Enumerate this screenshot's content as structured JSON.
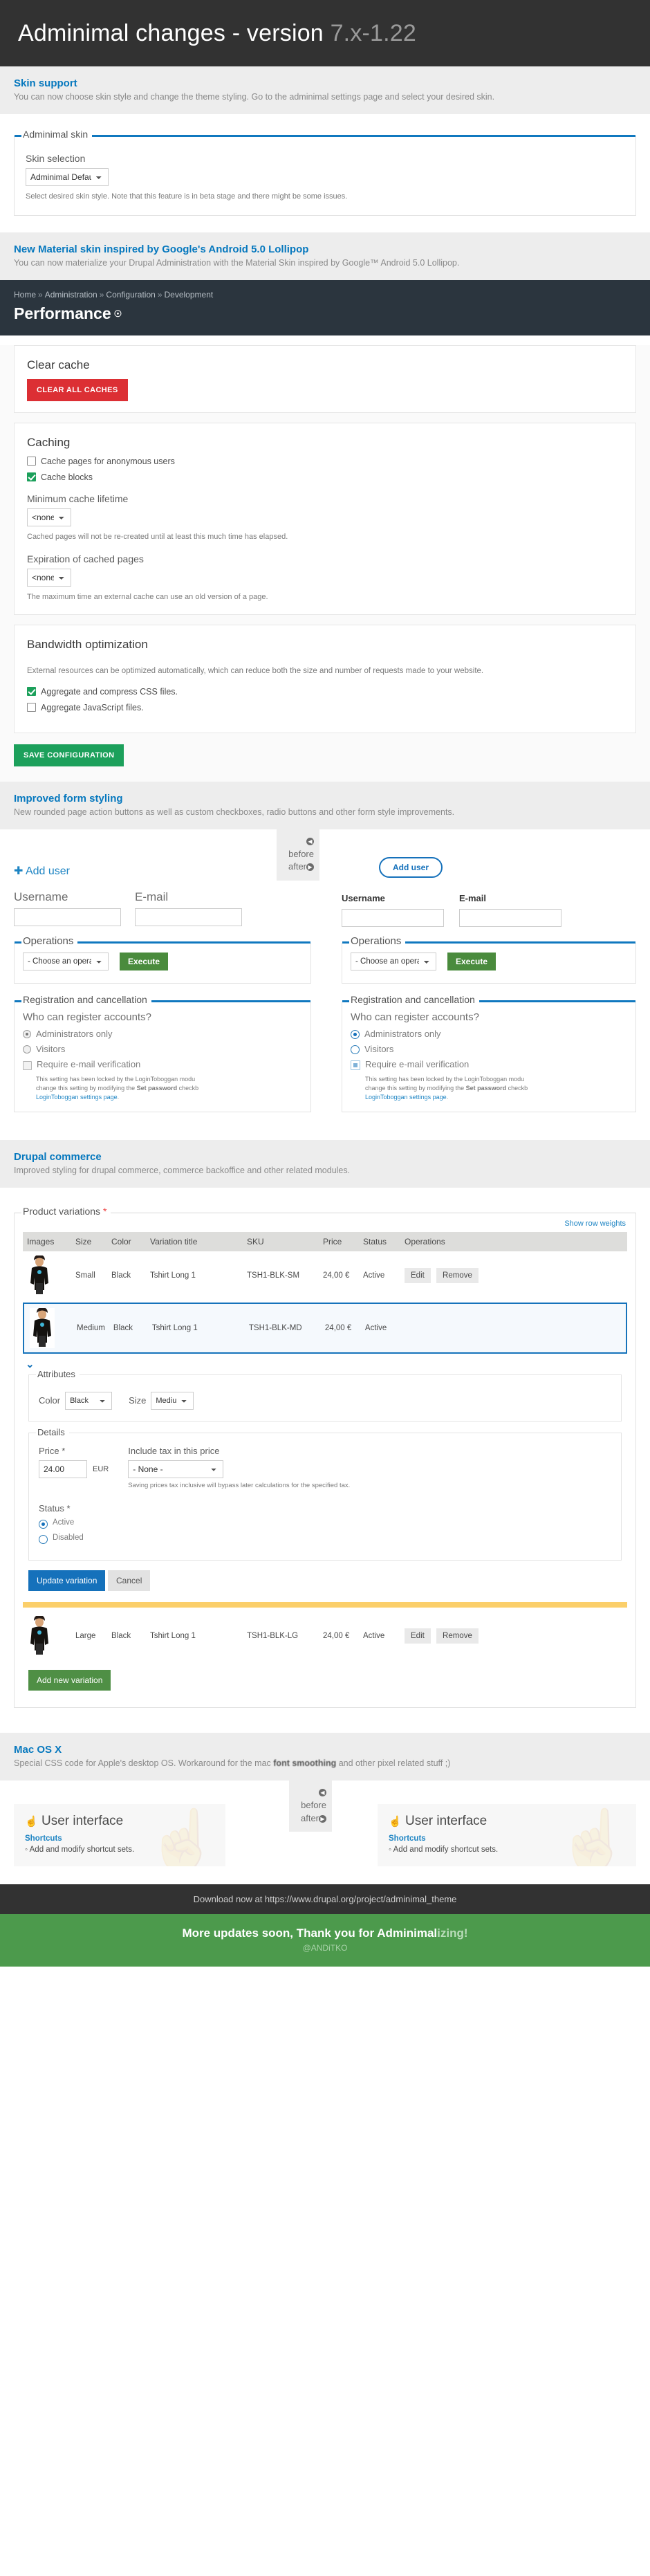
{
  "hero": {
    "title": "Adminimal changes - version ",
    "version": "7.x-1.22"
  },
  "promos": {
    "skin": {
      "heading": "Skin support",
      "text": "You can now choose skin style and change the theme styling. Go to the adminimal settings page and select your desired skin."
    },
    "material": {
      "heading": "New Material skin inspired by Google's Android 5.0 Lollipop",
      "text": "You can now materialize your Drupal Administration with the Material Skin inspired by Google™ Android 5.0 Lollipop."
    },
    "forms": {
      "heading": "Improved form styling",
      "text": "New rounded page action buttons as well as custom checkboxes, radio buttons and other form style improvements."
    },
    "commerce": {
      "heading": "Drupal commerce",
      "text": "Improved styling for drupal commerce, commerce backoffice and other related modules."
    },
    "macos": {
      "heading": "Mac OS X",
      "text_before": "Special CSS code for Apple's desktop OS. Workaround for the mac ",
      "text_highlight": "font smoothing",
      "text_after": " and other pixel related stuff ;)"
    }
  },
  "skin_fieldset": {
    "legend": "Adminimal skin",
    "field_label": "Skin selection",
    "selected": "Adminimal Default",
    "description": "Select desired skin style. Note that this feature is in beta stage and there might be some issues."
  },
  "admin_header": {
    "breadcrumb": [
      "Home",
      "Administration",
      "Configuration",
      "Development"
    ],
    "title": "Performance",
    "title_icon": "settings-icon"
  },
  "performance": {
    "clear_cache": {
      "heading": "Clear cache",
      "button": "CLEAR ALL CACHES"
    },
    "caching": {
      "heading": "Caching",
      "checkbox_anonymous": {
        "label": "Cache pages for anonymous users",
        "checked": false
      },
      "checkbox_blocks": {
        "label": "Cache blocks",
        "checked": true
      },
      "min_lifetime": {
        "label": "Minimum cache lifetime",
        "value": "<none>",
        "description": "Cached pages will not be re-created until at least this much time has elapsed."
      },
      "expiration": {
        "label": "Expiration of cached pages",
        "value": "<none>",
        "description": "The maximum time an external cache can use an old version of a page."
      }
    },
    "bandwidth": {
      "heading": "Bandwidth optimization",
      "description": "External resources can be optimized automatically, which can reduce both the size and number of requests made to your website.",
      "checkbox_css": {
        "label": "Aggregate and compress CSS files.",
        "checked": true
      },
      "checkbox_js": {
        "label": "Aggregate JavaScript files.",
        "checked": false
      }
    },
    "save_button": "SAVE CONFIGURATION"
  },
  "badge": {
    "before": "before",
    "after": "after"
  },
  "user_form": {
    "add_user_old": "Add user",
    "add_user_new": "Add user",
    "username_label": "Username",
    "email_label": "E-mail",
    "username_value": "",
    "email_value": "",
    "operations": {
      "legend": "Operations",
      "select_value": "- Choose an operation -",
      "execute_button": "Execute"
    },
    "registration": {
      "legend": "Registration and cancellation",
      "question": "Who can register accounts?",
      "options": [
        "Administrators only",
        "Visitors"
      ],
      "selected": "Administrators only",
      "verify_label": "Require e-mail verification",
      "verify_checked": false,
      "locked_text_1": "This setting has been locked by the LoginToboggan modu",
      "locked_text_2": "change this setting by modifying the ",
      "locked_bold": "Set password",
      "locked_text_3": " checkb",
      "locked_link": "LoginToboggan settings page",
      "locked_end": "."
    }
  },
  "commerce": {
    "legend": "Product variations",
    "legend_required": "*",
    "show_row_weights": "Show row weights",
    "columns": [
      "Images",
      "Size",
      "Color",
      "Variation title",
      "SKU",
      "Price",
      "Status",
      "Operations"
    ],
    "rows": [
      {
        "image": "tshirt-thumbnail",
        "size": "Small",
        "color": "Black",
        "title": "Tshirt Long 1",
        "sku": "TSH1-BLK-SM",
        "price": "24,00 €",
        "status": "Active",
        "ops": [
          "Edit",
          "Remove"
        ],
        "selected": false
      },
      {
        "image": "tshirt-thumbnail",
        "size": "Medium",
        "color": "Black",
        "title": "Tshirt Long 1",
        "sku": "TSH1-BLK-MD",
        "price": "24,00 €",
        "status": "Active",
        "ops": [],
        "selected": true
      },
      {
        "image": "tshirt-thumbnail",
        "size": "Large",
        "color": "Black",
        "title": "Tshirt Long 1",
        "sku": "TSH1-BLK-LG",
        "price": "24,00 €",
        "status": "Active",
        "ops": [
          "Edit",
          "Remove"
        ],
        "selected": false
      }
    ],
    "attributes": {
      "legend": "Attributes",
      "color_label": "Color",
      "color_value": "Black",
      "size_label": "Size",
      "size_value": "Medium"
    },
    "details": {
      "legend": "Details",
      "price_label": "Price",
      "price_required": "*",
      "price_value": "24.00",
      "currency": "EUR",
      "tax_label": "Include tax in this price",
      "tax_value": "- None -",
      "tax_description": "Saving prices tax inclusive will bypass later calculations for the specified tax.",
      "status_label": "Status",
      "status_required": "*",
      "status_options": [
        "Active",
        "Disabled"
      ],
      "status_selected": "Active"
    },
    "update_button": "Update variation",
    "cancel_button": "Cancel",
    "add_variation_button": "Add new variation"
  },
  "macos_cards": {
    "title": "User interface",
    "shortcuts": "Shortcuts",
    "item": "Add and modify shortcut sets."
  },
  "footer": {
    "download": "Download now at https://www.drupal.org/project/adminimal_theme",
    "thanks_main": "More updates soon, Thank you for Adminimal",
    "thanks_fade": "izing!",
    "author": "@ANDiTKO"
  }
}
